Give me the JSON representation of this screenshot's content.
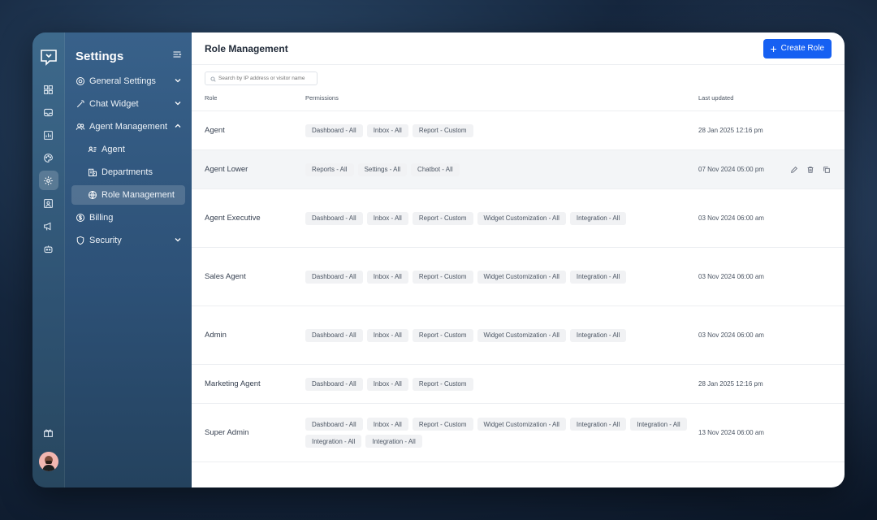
{
  "sidebar": {
    "title": "Settings",
    "items": [
      {
        "label": "General Settings",
        "icon": "gear-outline-icon"
      },
      {
        "label": "Chat Widget",
        "icon": "magic-wand-icon"
      },
      {
        "label": "Agent Management",
        "icon": "users-icon"
      },
      {
        "label": "Agent",
        "icon": "id-card-icon"
      },
      {
        "label": "Departments",
        "icon": "building-icon"
      },
      {
        "label": "Role Management",
        "icon": "globe-icon"
      },
      {
        "label": "Billing",
        "icon": "dollar-icon"
      },
      {
        "label": "Security",
        "icon": "shield-icon"
      }
    ]
  },
  "header": {
    "title": "Role Management",
    "create_label": "Create Role"
  },
  "search": {
    "placeholder": "Search by IP address or visitor name"
  },
  "table": {
    "columns": {
      "role": "Role",
      "permissions": "Permissions",
      "updated": "Last updated"
    },
    "rows": [
      {
        "role": "Agent",
        "permissions": [
          "Dashboard - All",
          "Inbox - All",
          "Report - Custom"
        ],
        "updated": "28 Jan 2025 12:16 pm"
      },
      {
        "role": "Agent Lower",
        "permissions": [
          "Reports - All",
          "Settings - All",
          "Chatbot - All"
        ],
        "updated": "07 Nov 2024 05:00 pm"
      },
      {
        "role": "Agent Executive",
        "permissions": [
          "Dashboard - All",
          "Inbox - All",
          "Report - Custom",
          "Widget Customization - All",
          "Integration - All"
        ],
        "updated": "03 Nov 2024 06:00 am"
      },
      {
        "role": "Sales Agent",
        "permissions": [
          "Dashboard - All",
          "Inbox - All",
          "Report - Custom",
          "Widget Customization - All",
          "Integration - All"
        ],
        "updated": "03 Nov 2024 06:00 am"
      },
      {
        "role": "Admin",
        "permissions": [
          "Dashboard - All",
          "Inbox - All",
          "Report - Custom",
          "Widget Customization - All",
          "Integration - All"
        ],
        "updated": "03 Nov 2024 06:00 am"
      },
      {
        "role": "Marketing Agent",
        "permissions": [
          "Dashboard - All",
          "Inbox - All",
          "Report - Custom"
        ],
        "updated": "28 Jan 2025 12:16 pm"
      },
      {
        "role": "Super Admin",
        "permissions": [
          "Dashboard - All",
          "Inbox - All",
          "Report - Custom",
          "Widget Customization - All",
          "Integration - All",
          "Integration - All",
          "Integration - All",
          "Integration - All"
        ],
        "updated": "13 Nov 2024 06:00 am"
      }
    ]
  },
  "colors": {
    "accent": "#1660f2",
    "sidebar": "#2d5177"
  }
}
